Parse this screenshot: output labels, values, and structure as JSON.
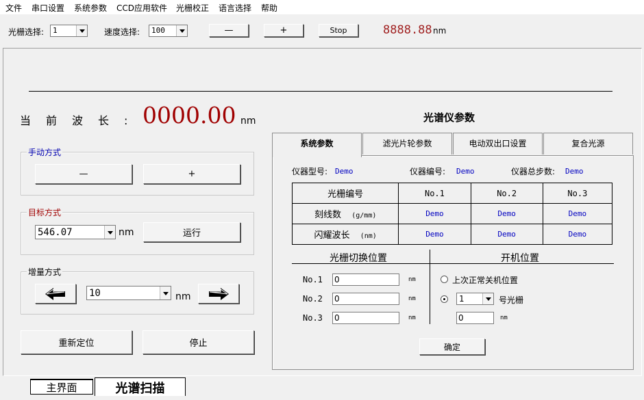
{
  "menu": [
    "文件",
    "串口设置",
    "系统参数",
    "CCD应用软件",
    "光栅校正",
    "语言选择",
    "帮助"
  ],
  "toolbar": {
    "grating_label": "光栅选择:",
    "grating_value": "1",
    "speed_label": "速度选择:",
    "speed_value": "100",
    "minus_label": "—",
    "plus_label": "+",
    "stop_label": "Stop",
    "wavelength_readout": "8888.88",
    "readout_unit": "nm"
  },
  "current": {
    "label": "当前波长:",
    "value": "0000.00",
    "unit": "nm"
  },
  "spectrometer_title": "光谱仪参数",
  "manual": {
    "title": "手动方式",
    "minus_label": "—",
    "plus_label": "+"
  },
  "target": {
    "title": "目标方式",
    "value": "546.07",
    "unit": "nm",
    "run_label": "运行"
  },
  "increment": {
    "title": "增量方式",
    "value": "10",
    "unit": "nm"
  },
  "actions": {
    "reposition_label": "重新定位",
    "stop_label": "停止"
  },
  "tabs": [
    "系统参数",
    "滤光片轮参数",
    "电动双出口设置",
    "复合光源"
  ],
  "info": {
    "model_label": "仪器型号:",
    "model_value": "Demo",
    "serial_label": "仪器编号:",
    "serial_value": "Demo",
    "steps_label": "仪器总步数:",
    "steps_value": "Demo"
  },
  "grating_table": {
    "header": [
      "光栅编号",
      "No.1",
      "No.2",
      "No.3"
    ],
    "rows": [
      {
        "label": "刻线数",
        "unit": "(g/mm)",
        "values": [
          "Demo",
          "Demo",
          "Demo"
        ]
      },
      {
        "label": "闪耀波长",
        "unit": "(nm)",
        "values": [
          "Demo",
          "Demo",
          "Demo"
        ]
      }
    ]
  },
  "switch_pos": {
    "title": "光栅切换位置",
    "rows": [
      {
        "label": "No.1",
        "value": "0",
        "unit": "nm"
      },
      {
        "label": "No.2",
        "value": "0",
        "unit": "nm"
      },
      {
        "label": "No.3",
        "value": "0",
        "unit": "nm"
      }
    ]
  },
  "boot_pos": {
    "title": "开机位置",
    "last_label": "上次正常关机位置",
    "grating_value": "1",
    "grating_suffix": "号光栅",
    "pos_value": "0",
    "pos_unit": "nm"
  },
  "confirm_label": "确定",
  "bottom_tabs": [
    "主界面",
    "光谱扫描"
  ]
}
